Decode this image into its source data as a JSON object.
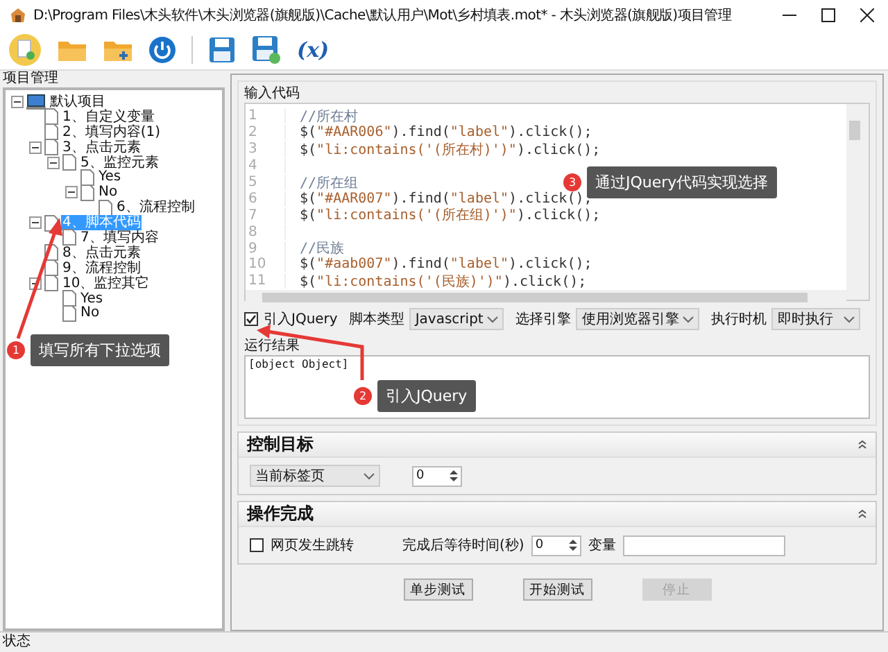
{
  "window": {
    "title": "D:\\Program Files\\木头软件\\木头浏览器(旗舰版)\\Cache\\默认用户\\Mot\\乡村填表.mot* - 木头浏览器(旗舰版)项目管理"
  },
  "toolbar": {
    "formula_label": "(x)"
  },
  "tree": {
    "title": "项目管理",
    "items": [
      {
        "label": "默认项目",
        "selected": false,
        "expanded": true,
        "children": [
          {
            "label": "1、自定义变量",
            "selected": false
          },
          {
            "label": "2、填写内容(1)",
            "selected": false
          },
          {
            "label": "3、点击元素",
            "selected": false,
            "expanded": true,
            "children": [
              {
                "label": "5、监控元素",
                "selected": false,
                "expanded": true,
                "children": [
                  {
                    "label": "Yes",
                    "selected": false
                  },
                  {
                    "label": "No",
                    "selected": false,
                    "expanded": true,
                    "children": [
                      {
                        "label": "6、流程控制",
                        "selected": false
                      }
                    ]
                  }
                ]
              }
            ]
          },
          {
            "label": "4、脚本代码",
            "selected": true,
            "expanded": true,
            "children": [
              {
                "label": "7、填写内容",
                "selected": false
              }
            ]
          },
          {
            "label": "8、点击元素",
            "selected": false
          },
          {
            "label": "9、流程控制",
            "selected": false
          },
          {
            "label": "10、监控其它",
            "selected": false,
            "expanded": true,
            "children": [
              {
                "label": "Yes",
                "selected": false
              },
              {
                "label": "No",
                "selected": false
              }
            ]
          }
        ]
      }
    ]
  },
  "code": {
    "title": "输入代码",
    "lines": [
      {
        "number": "1",
        "tokens": [
          {
            "kind": "comment",
            "text": "//所在村"
          }
        ]
      },
      {
        "number": "2",
        "tokens": [
          {
            "kind": "plain",
            "text": "$("
          },
          {
            "kind": "string",
            "text": "\"#AAR006\""
          },
          {
            "kind": "plain",
            "text": ").find("
          },
          {
            "kind": "string",
            "text": "\"label\""
          },
          {
            "kind": "plain",
            "text": ").click();"
          }
        ]
      },
      {
        "number": "3",
        "tokens": [
          {
            "kind": "plain",
            "text": "$("
          },
          {
            "kind": "string",
            "text": "\"li:contains('(所在村)')\""
          },
          {
            "kind": "plain",
            "text": ").click();"
          }
        ]
      },
      {
        "number": "4"
      },
      {
        "number": "5",
        "tokens": [
          {
            "kind": "comment",
            "text": "//所在组"
          }
        ]
      },
      {
        "number": "6",
        "tokens": [
          {
            "kind": "plain",
            "text": "$("
          },
          {
            "kind": "string",
            "text": "\"#AAR007\""
          },
          {
            "kind": "plain",
            "text": ").find("
          },
          {
            "kind": "string",
            "text": "\"label\""
          },
          {
            "kind": "plain",
            "text": ").click();"
          }
        ]
      },
      {
        "number": "7",
        "tokens": [
          {
            "kind": "plain",
            "text": "$("
          },
          {
            "kind": "string",
            "text": "\"li:contains('(所在组)')\""
          },
          {
            "kind": "plain",
            "text": ").click();"
          }
        ]
      },
      {
        "number": "8"
      },
      {
        "number": "9",
        "tokens": [
          {
            "kind": "comment",
            "text": "//民族"
          }
        ]
      },
      {
        "number": "10",
        "tokens": [
          {
            "kind": "plain",
            "text": "$("
          },
          {
            "kind": "string",
            "text": "\"#aab007\""
          },
          {
            "kind": "plain",
            "text": ").find("
          },
          {
            "kind": "string",
            "text": "\"label\""
          },
          {
            "kind": "plain",
            "text": ").click();"
          }
        ]
      },
      {
        "number": "11",
        "tokens": [
          {
            "kind": "plain",
            "text": "$("
          },
          {
            "kind": "string",
            "text": "\"li:contains('(民族)')\""
          },
          {
            "kind": "plain",
            "text": ").click();"
          }
        ]
      }
    ]
  },
  "options": {
    "jquery": {
      "label": "引入JQuery",
      "checked": true
    },
    "script_type": {
      "label": "脚本类型",
      "value": "Javascript"
    },
    "engine": {
      "label": "选择引擎",
      "value": "使用浏览器引擎"
    },
    "timing": {
      "label": "执行时机",
      "value": "即时执行"
    }
  },
  "result": {
    "title": "运行结果",
    "value": "[object Object]"
  },
  "control_target": {
    "title": "控制目标",
    "target": "当前标签页",
    "index": "0"
  },
  "completion": {
    "title": "操作完成",
    "redirect": {
      "label": "网页发生跳转",
      "checked": false
    },
    "wait_label": "完成后等待时间(秒)",
    "wait": "0",
    "variable_label": "变量"
  },
  "buttons": [
    {
      "label": "单步测试",
      "disabled": false
    },
    {
      "label": "开始测试",
      "disabled": false
    },
    {
      "label": "停止",
      "disabled": true
    }
  ],
  "status_bar": "状态",
  "callouts": [
    {
      "number": "1",
      "text": "填写所有下拉选项"
    },
    {
      "number": "2",
      "text": "引入JQuery"
    },
    {
      "number": "3",
      "text": "通过JQuery代码实现选择"
    }
  ]
}
